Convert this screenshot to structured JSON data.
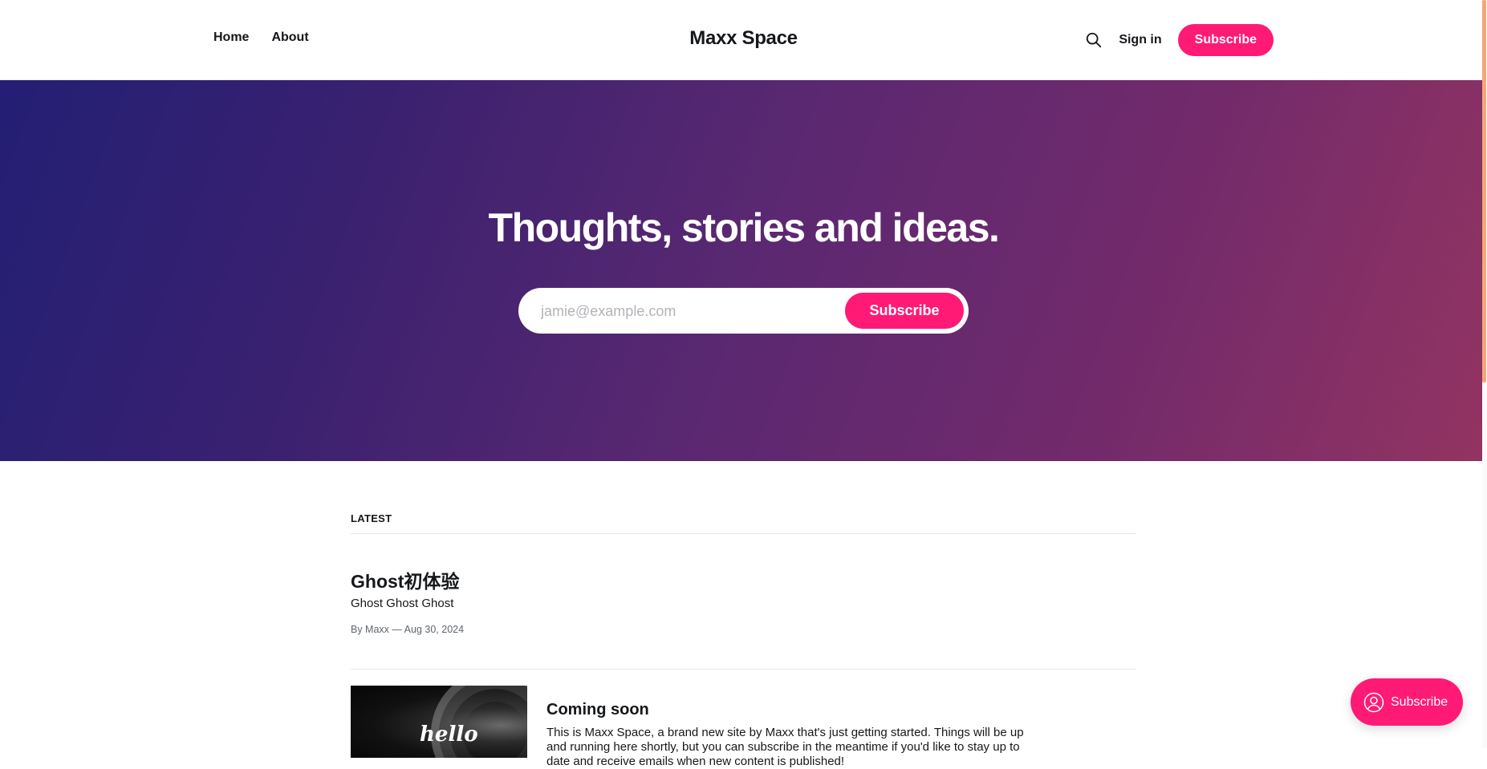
{
  "header": {
    "nav": [
      {
        "label": "Home"
      },
      {
        "label": "About"
      }
    ],
    "site_title": "Maxx Space",
    "search_icon": "search-icon",
    "signin_label": "Sign in",
    "subscribe_label": "Subscribe"
  },
  "hero": {
    "title": "Thoughts, stories and ideas.",
    "email_placeholder": "jamie@example.com",
    "subscribe_label": "Subscribe"
  },
  "feed": {
    "section_label": "LATEST",
    "posts": [
      {
        "title": "Ghost初体验",
        "excerpt": "Ghost Ghost Ghost",
        "meta": "By Maxx — Aug 30, 2024"
      },
      {
        "title": "Coming soon",
        "excerpt": "This is Maxx Space, a brand new site by Maxx that's just getting started. Things will be up and running here shortly, but you can subscribe in the meantime if you'd like to stay up to date and receive emails when new content is published!",
        "image_text": "hello"
      }
    ]
  },
  "portal": {
    "label": "Subscribe",
    "icon": "user-circle-icon"
  },
  "colors": {
    "accent": "#ff1a75",
    "hero_gradient_start": "#231f74",
    "hero_gradient_end": "#933462"
  }
}
